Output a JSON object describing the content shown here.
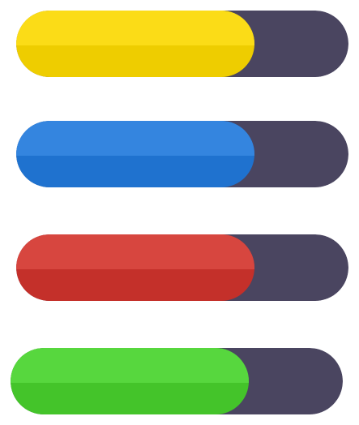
{
  "colors": {
    "track": "#4a4560"
  },
  "progress_bars": [
    {
      "name": "yellow",
      "fill_fraction": 0.717,
      "fill_color": "#eecd00",
      "highlight_color": "#fbdc17"
    },
    {
      "name": "blue",
      "fill_fraction": 0.717,
      "fill_color": "#1f72cf",
      "highlight_color": "#3485df"
    },
    {
      "name": "red",
      "fill_fraction": 0.717,
      "fill_color": "#c4302a",
      "highlight_color": "#d7463f"
    },
    {
      "name": "green",
      "fill_fraction": 0.717,
      "fill_color": "#44c42a",
      "highlight_color": "#57d73e"
    }
  ]
}
